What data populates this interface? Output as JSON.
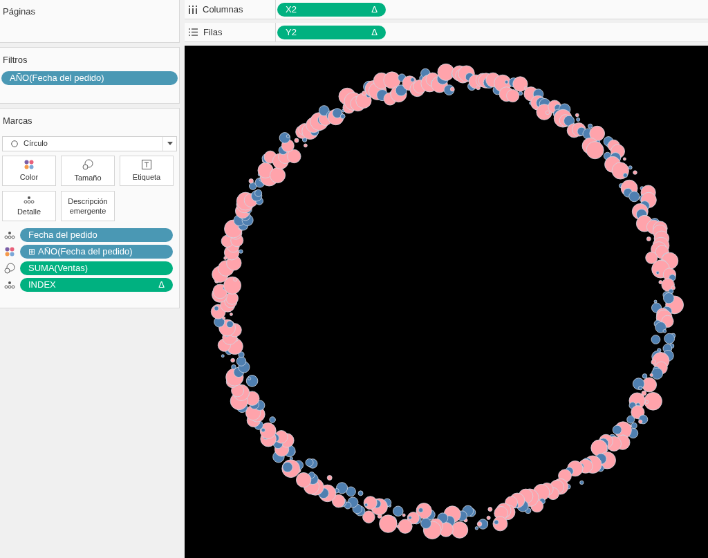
{
  "pages": {
    "title": "Páginas"
  },
  "filters": {
    "title": "Filtros",
    "pills": [
      {
        "label": "AÑO(Fecha del pedido)",
        "color": "#4a98b4"
      }
    ]
  },
  "marks": {
    "title": "Marcas",
    "mark_type": "Círculo",
    "buttons": [
      {
        "label": "Color",
        "kind": "color"
      },
      {
        "label": "Tamaño",
        "kind": "size"
      },
      {
        "label": "Etiqueta",
        "kind": "label"
      },
      {
        "label": "Detalle",
        "kind": "detail"
      },
      {
        "label": "Descripción emergente",
        "kind": "tooltip"
      }
    ],
    "pills": [
      {
        "kind": "detail",
        "label": "Fecha del pedido",
        "color": "#4a98b4"
      },
      {
        "kind": "color",
        "prefix": "⊞",
        "label": "AÑO(Fecha del pedido)",
        "color": "#4a98b4"
      },
      {
        "kind": "size",
        "label": "SUMA(Ventas)",
        "color": "#00b180"
      },
      {
        "kind": "detail",
        "label": "INDEX",
        "color": "#00b180",
        "suffix": "Δ"
      }
    ]
  },
  "shelves": [
    {
      "kind": "columns",
      "label": "Columnas",
      "pill": {
        "label": "X2",
        "color": "#00b180",
        "suffix": "Δ"
      }
    },
    {
      "kind": "rows",
      "label": "Filas",
      "pill": {
        "label": "Y2",
        "color": "#00b180",
        "suffix": "Δ"
      }
    }
  ]
}
